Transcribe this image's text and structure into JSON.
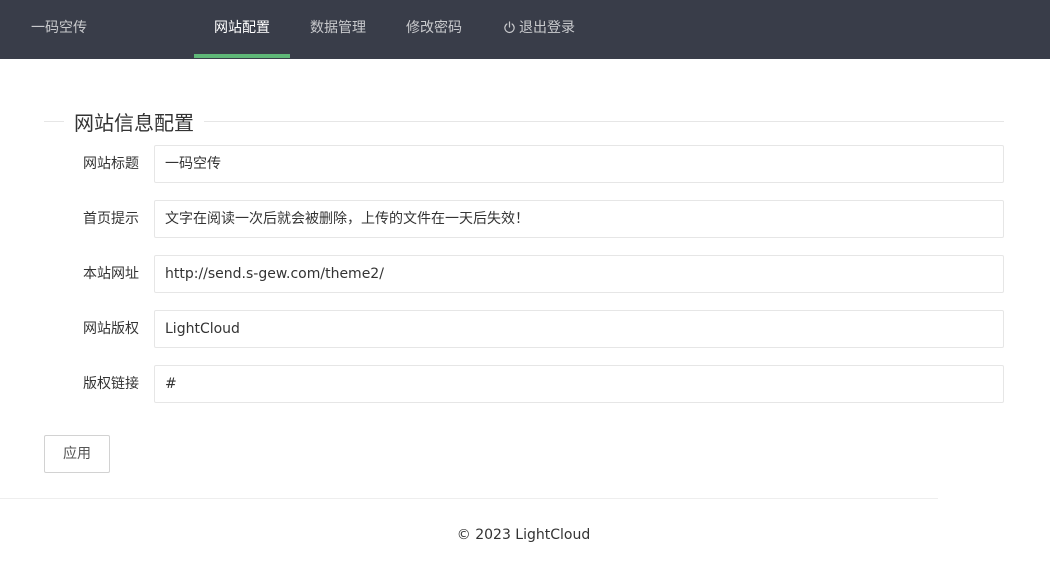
{
  "header": {
    "brand": "一码空传",
    "nav": [
      {
        "label": "网站配置",
        "active": true
      },
      {
        "label": "数据管理",
        "active": false
      },
      {
        "label": "修改密码",
        "active": false
      },
      {
        "label": "退出登录",
        "active": false,
        "icon": "power-icon"
      }
    ],
    "accent_color": "#5fb878",
    "background_color": "#393d49"
  },
  "form": {
    "legend": "网站信息配置",
    "fields": [
      {
        "label": "网站标题",
        "value": "一码空传"
      },
      {
        "label": "首页提示",
        "value": "文字在阅读一次后就会被删除，上传的文件在一天后失效！"
      },
      {
        "label": "本站网址",
        "value": "http://send.s-gew.com/theme2/"
      },
      {
        "label": "网站版权",
        "value": "LightCloud"
      },
      {
        "label": "版权链接",
        "value": "#"
      }
    ],
    "submit_label": "应用"
  },
  "footer": {
    "text": "© 2023 LightCloud"
  }
}
